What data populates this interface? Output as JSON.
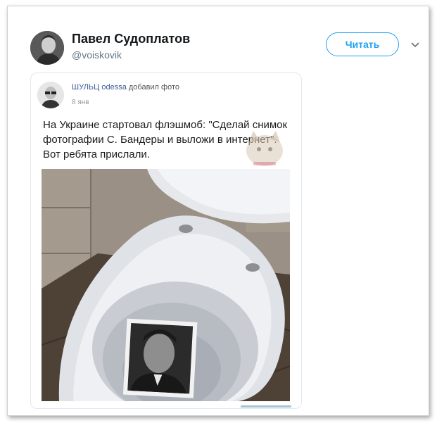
{
  "tweet": {
    "author_name": "Павел Судоплатов",
    "author_handle": "@voiskovik",
    "follow_label": "Читать",
    "menu_icon": "chevron-down-icon"
  },
  "embedded_post": {
    "poster_name": "ШУЛЬЦ odessa",
    "action": " добавил фото",
    "date": "8 янв",
    "text": "На Украине стартовал флэшмоб: \"Сделай снимок фотографии С. Бандеры и выложи в интернет\". Вот ребята прислали."
  },
  "colors": {
    "accent": "#1da1f2",
    "name_link": "#3b5998",
    "handle": "#657786"
  }
}
